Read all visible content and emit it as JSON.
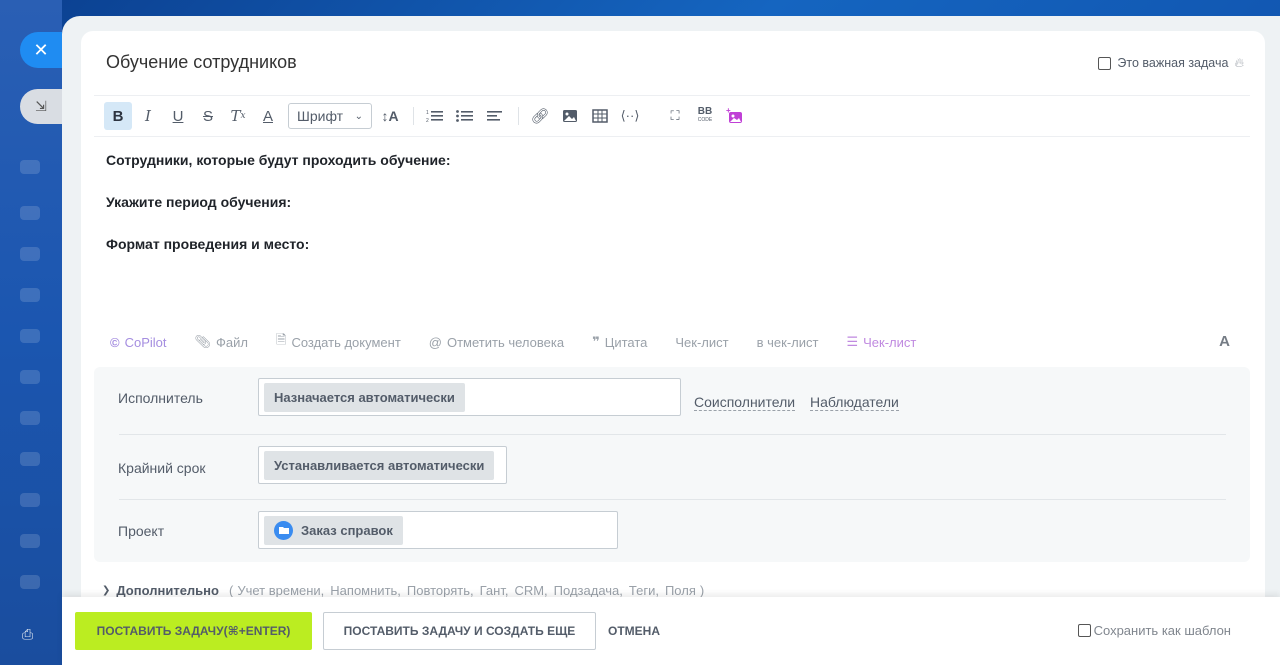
{
  "task": {
    "title": "Обучение сотрудников",
    "important_label": "Это важная задача"
  },
  "editor": {
    "font_select": "Шрифт",
    "lines": [
      "Сотрудники, которые будут проходить обучение:",
      "Укажите период обучения:",
      "Формат проведения и место:"
    ]
  },
  "attach_bar": {
    "items": [
      "CoPilot",
      "Файл",
      "Создать документ",
      "Отметить человека",
      "Цитата",
      "Чек-лист",
      "в чек-лист",
      "Чек-лист"
    ],
    "font_toggle": "A"
  },
  "props": {
    "assignee_label": "Исполнитель",
    "assignee_value": "Назначается автоматически",
    "coassignees_link": "Соисполнители",
    "observers_link": "Наблюдатели",
    "deadline_label": "Крайний срок",
    "deadline_value": "Устанавливается автоматически",
    "project_label": "Проект",
    "project_value": "Заказ справок"
  },
  "more": {
    "label": "Дополнительно",
    "open": "(",
    "items": [
      "Учет времени,",
      "Напомнить,",
      "Повторять,",
      "Гант,",
      "CRM,",
      "Подзадача,",
      "Теги,",
      "Поля"
    ],
    "close": ")"
  },
  "footer": {
    "primary_button": "ПОСТАВИТЬ ЗАДАЧУ(⌘+ENTER)",
    "secondary_button": "ПОСТАВИТЬ ЗАДАЧУ И СОЗДАТЬ ЕЩЕ",
    "cancel_button": "ОТМЕНА",
    "save_template": "Сохранить как шаблон"
  }
}
